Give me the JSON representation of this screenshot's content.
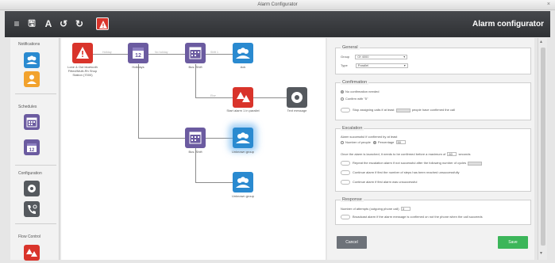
{
  "window": {
    "title": "Alarm Configurator",
    "close_glyph": "×"
  },
  "toolbar": {
    "list_glyph": "≡",
    "save_glyph": "🖫",
    "text_glyph": "A",
    "undo_glyph": "↺",
    "redo_glyph": "↻",
    "app_title": "Alarm configurator"
  },
  "sidebar": {
    "notifications_label": "Notifications",
    "schedules_label": "Schedules",
    "configuration_label": "Configuration",
    "flow_control_label": "Flow Control"
  },
  "canvas": {
    "nodes": [
      {
        "label": "Lone & Out bluetooth Fitted/Multi-Rh Shop Station (7000)"
      },
      {
        "label": "Holidays"
      },
      {
        "label": "Bus. Shift"
      },
      {
        "label": "Ack"
      },
      {
        "label": "Start alarm 1 in parallel"
      },
      {
        "label": "Text message"
      },
      {
        "label": "Bus. Shift"
      },
      {
        "label": "Unknown group"
      },
      {
        "label": "Unknown group"
      }
    ],
    "wire_labels": [
      "Holiday",
      "No holiday",
      "Shift 1",
      "Else"
    ]
  },
  "panel": {
    "general": {
      "title": "General",
      "group_label": "Group",
      "group_value": "Of 4000",
      "type_label": "Type",
      "type_value": "Parallel"
    },
    "confirmation": {
      "title": "Confirmation",
      "opt1": "No confirmation needed",
      "opt2": "Confirm with \"5\"",
      "stop_text": "Stop assigning calls if at least",
      "stop_suffix": "people have confirmed the call"
    },
    "escalation": {
      "title": "Escalation",
      "intro": "Alarm successful if confirmed by at least",
      "opt1": "Number of people",
      "opt2": "Percentage",
      "pct_value": "50",
      "repeat_text": "Once the alarm is launched, it needs to be confirmed before a maximum of",
      "repeat_value": "60",
      "repeat_unit": "seconds",
      "repeat_toggle": "Repeat the escalation alarm if not successful after the following number of cycles",
      "continue1": "Continue alarm if first the number of steps has been reached unsuccessfully",
      "continue2": "Continue alarm if first alarm was unsuccessful"
    },
    "response": {
      "title": "Response",
      "attempts_label": "Number of attempts (outgoing phone call)",
      "attempts_value": "3",
      "toggle_text": "Broadcast alarm if the alarm message is confirmed on not the phone when the call succeeds"
    }
  },
  "buttons": {
    "cancel": "Cancel",
    "save": "Save"
  },
  "colors": {
    "toolbar": "#3a3c40",
    "alarm_red": "#d9342b",
    "schedule_purple": "#6b5ba0",
    "group_blue": "#2a8ad0",
    "notify_orange": "#f2a22d",
    "config_dark": "#55595e",
    "save_green": "#3cb65a",
    "cancel_gray": "#6d7279"
  }
}
